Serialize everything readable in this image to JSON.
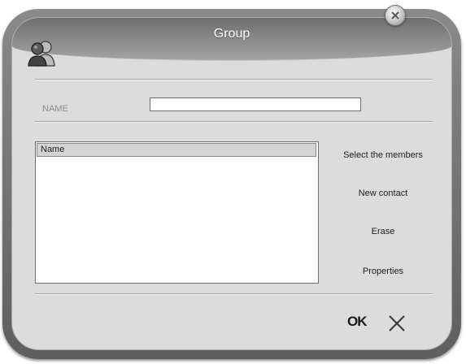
{
  "window": {
    "title": "Group"
  },
  "form": {
    "name_label": "NAME",
    "name_value": "",
    "name_placeholder": ""
  },
  "members_list": {
    "column_header": "Name",
    "rows": []
  },
  "actions": {
    "select_members": "Select the members",
    "new_contact": "New contact",
    "erase": "Erase",
    "properties": "Properties"
  },
  "footer": {
    "ok_label": "OK"
  },
  "icons": {
    "title_icon": "group-icon",
    "close": "close-icon",
    "cancel": "cancel-x-icon"
  }
}
